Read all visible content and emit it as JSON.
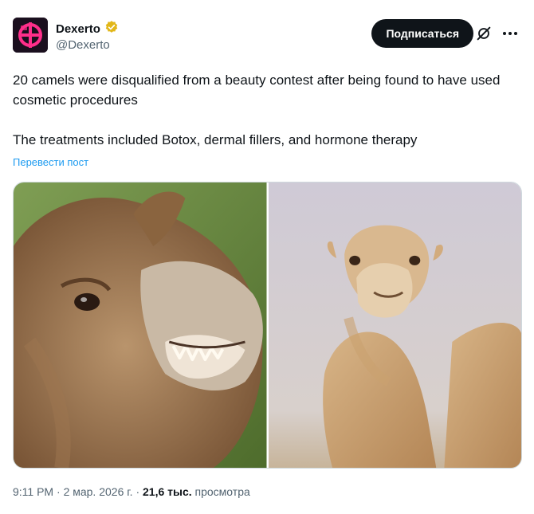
{
  "author": {
    "name": "Dexerto",
    "handle": "@Dexerto",
    "verified_badge": "verified-gold-icon",
    "brand_color": "#ff2e8a"
  },
  "actions": {
    "subscribe_label": "Подписаться",
    "grok_icon": "grok-icon",
    "more_icon": "more-horizontal-icon"
  },
  "post": {
    "paragraphs": [
      "20 camels were disqualified from a beauty contest after being found to have used cosmetic procedures",
      "The treatments included Botox, dermal fillers, and hormone therapy"
    ],
    "translate_label": "Перевести пост"
  },
  "media": {
    "images": [
      {
        "subject": "camel-closeup-showing-teeth"
      },
      {
        "subject": "camel-portrait-neutral-background"
      }
    ]
  },
  "meta": {
    "time": "9:11 PM",
    "separator": "·",
    "date": "2 мар. 2026 г.",
    "views_count": "21,6 тыс.",
    "views_label": "просмотра"
  }
}
